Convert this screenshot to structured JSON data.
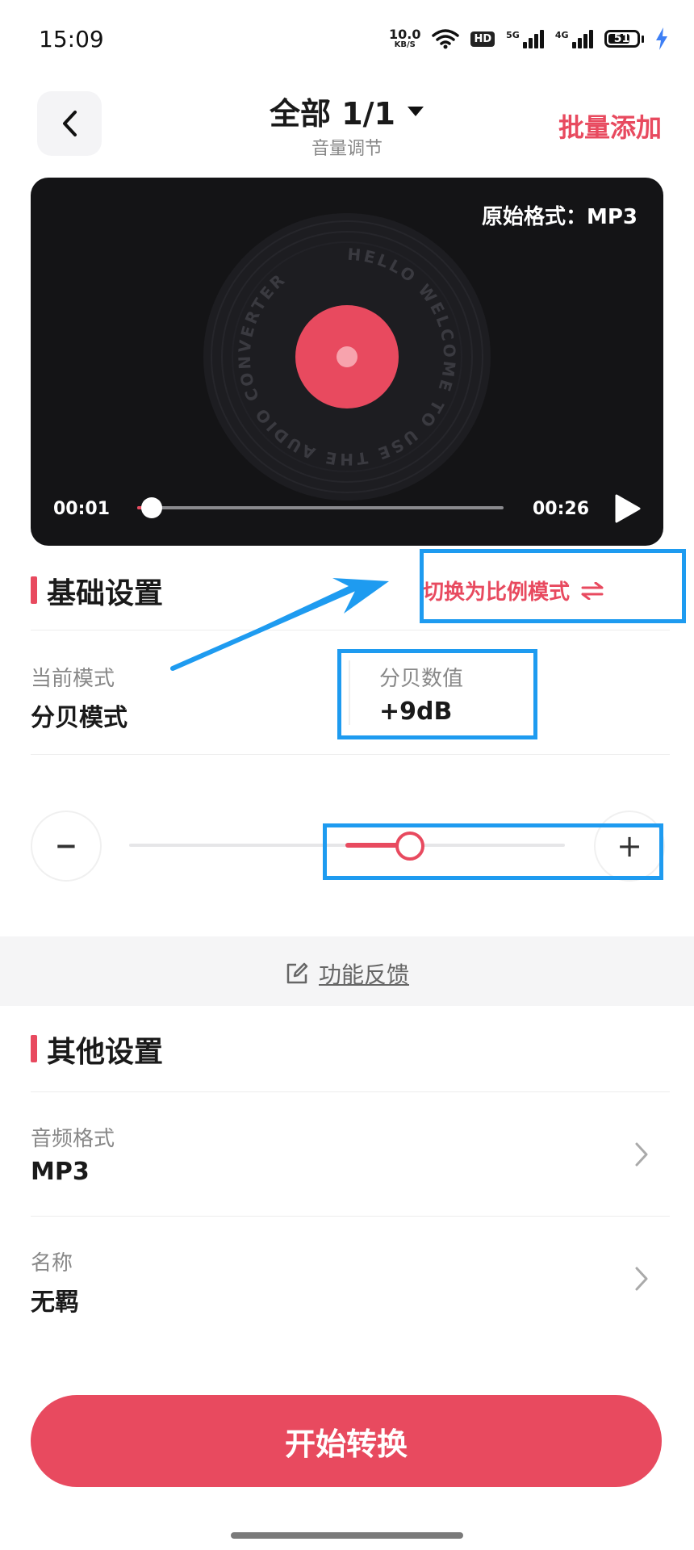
{
  "status_bar": {
    "time": "15:09",
    "net_speed_value": "10.0",
    "net_speed_unit": "KB/S",
    "hd_badge": "HD",
    "signal1_type": "5G",
    "signal2_type": "4G",
    "battery": "51"
  },
  "header": {
    "title": "全部 1/1",
    "subtitle": "音量调节",
    "batch_add": "批量添加"
  },
  "player": {
    "original_format": "原始格式：MP3",
    "disc_text": "HELLO WELCOME TO USE THE AUDIO CONVERTER",
    "current_time": "00:01",
    "total_time": "00:26",
    "progress_fraction": 0.04
  },
  "basic_settings": {
    "title": "基础设置",
    "switch_label": "切换为比例模式",
    "mode_label": "当前模式",
    "mode_value": "分贝模式",
    "db_label": "分贝数值",
    "db_value": "+9dB"
  },
  "volume_slider": {
    "minus_label": "−",
    "plus_label": "+"
  },
  "feedback": {
    "label": "功能反馈"
  },
  "other_settings": {
    "title": "其他设置",
    "format_label": "音频格式",
    "format_value": "MP3",
    "name_label": "名称",
    "name_value": "无羁"
  },
  "start_button": {
    "label": "开始转换"
  },
  "colors": {
    "accent": "#e84a5f",
    "player_bg": "#141416",
    "annotation": "#1e9bf0"
  }
}
